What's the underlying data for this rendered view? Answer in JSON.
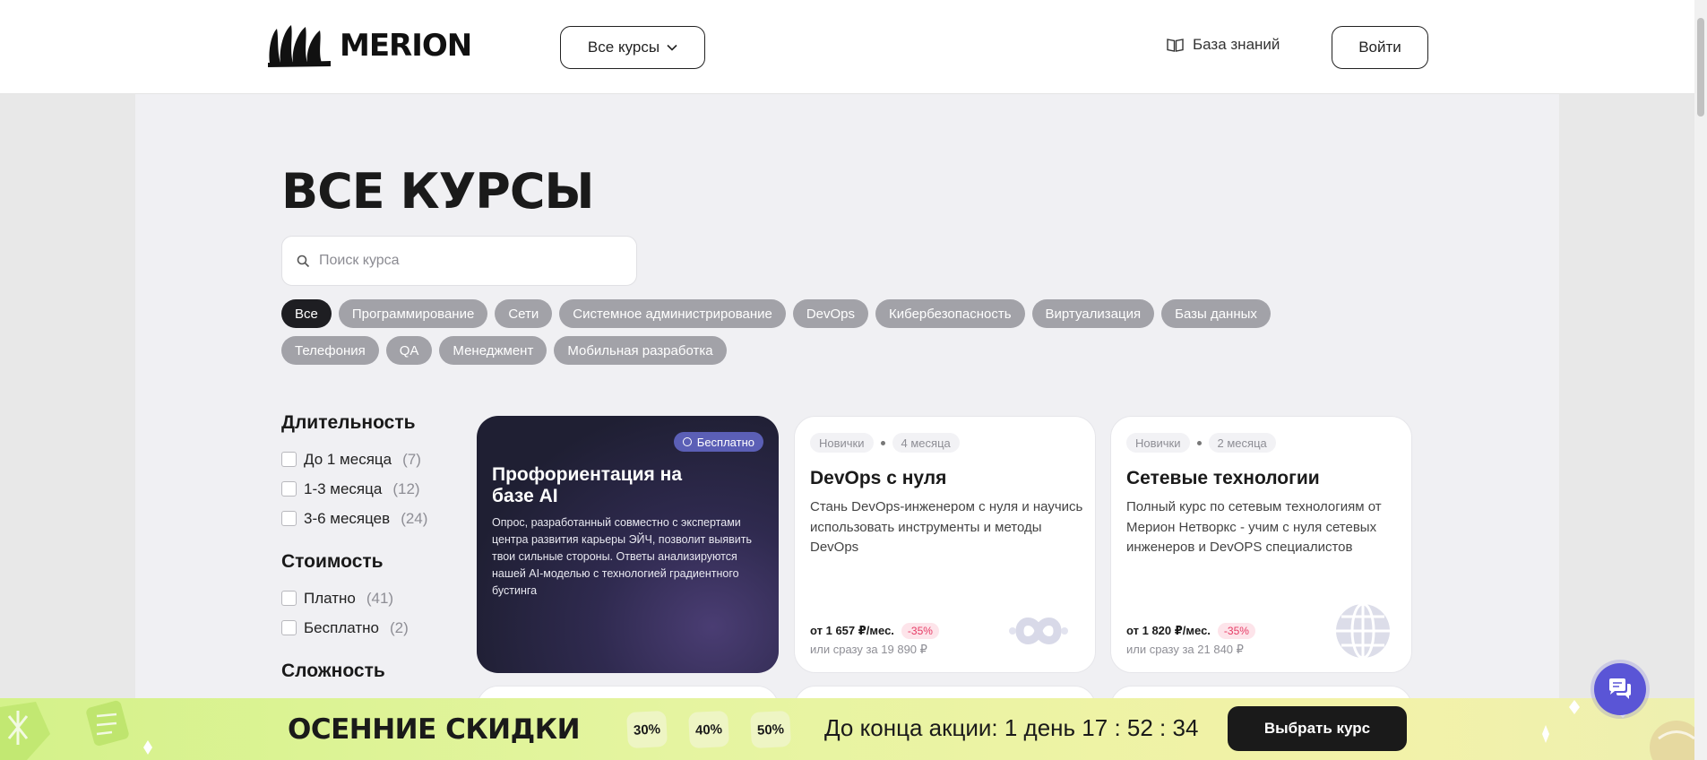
{
  "header": {
    "logo_text": "MERION",
    "all_courses_label": "Все курсы",
    "knowledge_base_label": "База знаний",
    "login_label": "Войти"
  },
  "page": {
    "title": "ВСЕ КУРСЫ",
    "search_placeholder": "Поиск курса"
  },
  "tags": {
    "row1": [
      "Все",
      "Программирование",
      "Сети",
      "Системное администрирование",
      "DevOps",
      "Кибербезопасность",
      "Виртуализация",
      "Базы данных"
    ],
    "row2": [
      "Телефония",
      "QA",
      "Менеджмент",
      "Мобильная разработка"
    ],
    "active": "Все"
  },
  "filters": {
    "duration": {
      "title": "Длительность",
      "items": [
        {
          "label": "До 1 месяца",
          "count": "(7)"
        },
        {
          "label": "1-3 месяца",
          "count": "(12)"
        },
        {
          "label": "3-6 месяцев",
          "count": "(24)"
        }
      ]
    },
    "price": {
      "title": "Стоимость",
      "items": [
        {
          "label": "Платно",
          "count": "(41)"
        },
        {
          "label": "Бесплатно",
          "count": "(2)"
        }
      ]
    },
    "difficulty": {
      "title": "Сложность"
    }
  },
  "cards": {
    "ai": {
      "badge": "Бесплатно",
      "title": "Профориентация на базе AI",
      "description": "Опрос, разработанный совместно с экспертами центра развития карьеры ЭЙЧ, позволит выявить твои сильные стороны. Ответы анализируются нашей AI-моделью с технологией градиентного бустинга"
    },
    "devops": {
      "level": "Новички",
      "duration": "4 месяца",
      "title": "DevOps с нуля",
      "description": "Стань DevOps-инженером с нуля и научись использовать инструменты и методы DevOps",
      "price": "от 1 657 ₽/мес.",
      "discount": "-35%",
      "full_price": "или сразу за 19 890 ₽",
      "icon": "infinity-icon"
    },
    "network": {
      "level": "Новички",
      "duration": "2 месяца",
      "title": "Сетевые технологии",
      "description": "Полный курс по сетевым технологиям от Мерион Нетворкс - учим с нуля сетевых инженеров и DevOPS специалистов",
      "price": "от 1 820 ₽/мес.",
      "discount": "-35%",
      "full_price": "или сразу за 21 840 ₽",
      "icon": "globe-icon"
    }
  },
  "promo": {
    "title": "ОСЕННИЕ СКИДКИ",
    "chips": [
      "30%",
      "40%",
      "50%"
    ],
    "timer_text": "До конца акции: 1 день 17 : 52 : 34",
    "button_label": "Выбрать курс"
  },
  "colors": {
    "accent": "#5a55d6",
    "tag_active": "#1e1e22",
    "tag_inactive": "#a2a2a8",
    "discount": "#e63b65",
    "promo_bg": "#d4f28a"
  }
}
